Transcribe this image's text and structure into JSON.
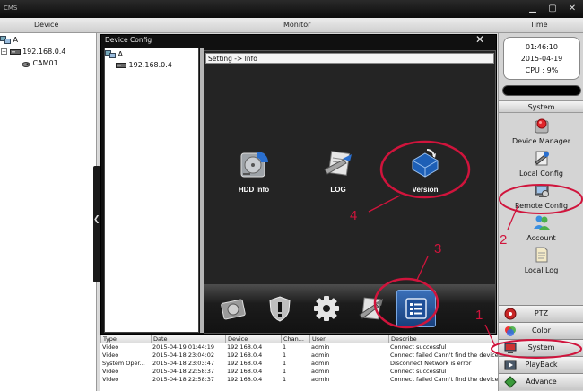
{
  "window": {
    "app_title": "CMS"
  },
  "columns": {
    "device": "Device",
    "monitor": "Monitor",
    "time": "Time"
  },
  "device_tree": {
    "root": "A",
    "ip": "192.168.0.4",
    "camera": "CAM01"
  },
  "dialog": {
    "title": "Device Config",
    "close_glyph": "✕",
    "tree": {
      "root": "A",
      "ip": "192.168.0.4"
    },
    "breadcrumb": "Setting -> Info",
    "info_items": [
      {
        "label": "HDD Info",
        "icon": "hdd-icon"
      },
      {
        "label": "LOG",
        "icon": "log-icon"
      },
      {
        "label": "Version",
        "icon": "version-icon"
      }
    ],
    "bottom_tabs": [
      "disk-icon",
      "shield-icon",
      "gear-icon",
      "tools-icon",
      "info-list-icon"
    ]
  },
  "status": {
    "time": "01:46:10",
    "date": "2015-04-19",
    "cpu": "CPU : 9%"
  },
  "system": {
    "header": "System",
    "items": [
      {
        "label": "Device Manager",
        "icon": "device-manager-icon"
      },
      {
        "label": "Local Config",
        "icon": "local-config-icon"
      },
      {
        "label": "Remote Config",
        "icon": "remote-config-icon"
      },
      {
        "label": "Account",
        "icon": "account-icon"
      },
      {
        "label": "Local Log",
        "icon": "local-log-icon"
      }
    ]
  },
  "nav": [
    "PTZ",
    "Color",
    "System",
    "PlayBack",
    "Advance"
  ],
  "log": {
    "headers": [
      "Type",
      "Date",
      "Device",
      "Chan...",
      "User",
      "Describe"
    ],
    "rows": [
      [
        "Video",
        "2015-04-19 01:44:19",
        "192.168.0.4",
        "1",
        "admin",
        "Connect successful"
      ],
      [
        "Video",
        "2015-04-18 23:04:02",
        "192.168.0.4",
        "1",
        "admin",
        "Connect failed Cann't find the device"
      ],
      [
        "System Oper...",
        "2015-04-18 23:03:47",
        "192.168.0.4",
        "1",
        "admin",
        "Disconnect Network is error"
      ],
      [
        "Video",
        "2015-04-18 22:58:37",
        "192.168.0.4",
        "1",
        "admin",
        "Connect successful"
      ],
      [
        "Video",
        "2015-04-18 22:58:37",
        "192.168.0.4",
        "1",
        "admin",
        "Connect failed Cann't find the device"
      ]
    ]
  },
  "annotations": [
    "1",
    "2",
    "3",
    "4"
  ],
  "colors": {
    "annotation": "#d0143c",
    "panel": "#242424",
    "active_tab": "#2f64ad"
  }
}
